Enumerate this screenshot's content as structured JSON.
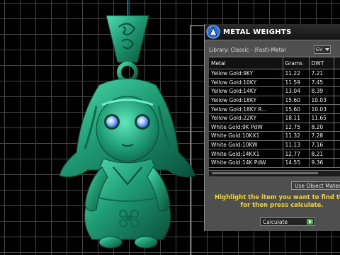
{
  "panel": {
    "title": "METAL WEIGHTS",
    "icon": "metal-weights-icon",
    "library_label": "Library: Classic - (Fast)-Metal",
    "gv_button": "GV"
  },
  "table": {
    "headers": [
      "Metal",
      "Grams",
      "DWT"
    ],
    "rows": [
      {
        "metal": "Yellow Gold:9KY",
        "grams": "11.22",
        "dwt": "7.21"
      },
      {
        "metal": "Yellow Gold:10KY",
        "grams": "11.59",
        "dwt": "7.45"
      },
      {
        "metal": "Yellow Gold:14KY",
        "grams": "13.04",
        "dwt": "8.39"
      },
      {
        "metal": "Yellow Gold:18KY",
        "grams": "15.60",
        "dwt": "10.03"
      },
      {
        "metal": "Yellow Gold:18KY R...",
        "grams": "15.60",
        "dwt": "10.03"
      },
      {
        "metal": "Yellow Gold:22KY",
        "grams": "18.11",
        "dwt": "11.65"
      },
      {
        "metal": "White Gold:9K PdW",
        "grams": "12.75",
        "dwt": "8.20"
      },
      {
        "metal": "White Gold:10KX1",
        "grams": "11.32",
        "dwt": "7.28"
      },
      {
        "metal": "White Gold:10KW",
        "grams": "11.13",
        "dwt": "7.16"
      },
      {
        "metal": "White Gold:14KX1",
        "grams": "12.77",
        "dwt": "8.21"
      },
      {
        "metal": "White Gold:14K PdW",
        "grams": "14.55",
        "dwt": "9.36"
      }
    ]
  },
  "use_material_button": "Use Object Material",
  "instruction": [
    "Highlight the item you want to find the w",
    "for then press calculate."
  ],
  "calculate_select": "Calculate",
  "colors": {
    "pendant": "#1f9b72",
    "instruction_text": "#f0d23a",
    "go_button": "#37b43a"
  }
}
